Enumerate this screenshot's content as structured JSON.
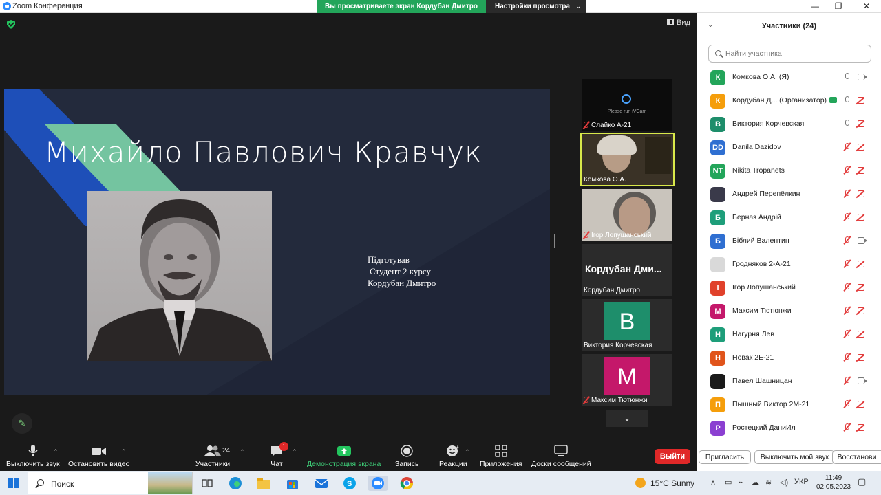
{
  "window": {
    "title": "Zoom Конференция",
    "share_banner": "Вы просматриваете экран Кордубан Дмитро",
    "view_settings": "Настройки просмотра",
    "view_label": "Вид"
  },
  "slide": {
    "name": "Михайло Павлович Кравчук",
    "credit_line1": "Підготував",
    "credit_line2": "Студент 2 курсу",
    "credit_line3": "Кордубан Дмитро"
  },
  "videos": [
    {
      "label": "Слайко А-21",
      "muted": true,
      "note": "Please run iVCam"
    },
    {
      "label": "Комкова О.А.",
      "muted": false
    },
    {
      "label": "Ігор Лопушанський",
      "muted": true
    },
    {
      "label": "Кордубан Дмитро",
      "muted": false,
      "big_name": "Кордубан Дми..."
    },
    {
      "label": "Виктория Корчевская",
      "muted": false,
      "letter": "В",
      "color": "#1e8e6b"
    },
    {
      "label": "Максим Тютюнжи",
      "muted": true,
      "letter": "М",
      "color": "#c4186a"
    }
  ],
  "toolbar": {
    "mute": "Выключить звук",
    "video": "Остановить видео",
    "participants": "Участники",
    "participants_count": "24",
    "chat": "Чат",
    "chat_badge": "1",
    "share": "Демонстрация экрана",
    "record": "Запись",
    "reactions": "Реакции",
    "apps": "Приложения",
    "whiteboards": "Доски сообщений",
    "leave": "Выйти"
  },
  "panel": {
    "title": "Участники (24)",
    "search_placeholder": "Найти участника",
    "participants": [
      {
        "avatar": "К",
        "color": "#23a55a",
        "name": "Комкова О.А. (Я)",
        "mic": "on",
        "cam": "on"
      },
      {
        "avatar": "К",
        "color": "#f59e0b",
        "name": "Кордубан Д... (Организатор)",
        "mic": "on",
        "cam": "off",
        "sharing": true
      },
      {
        "avatar": "В",
        "color": "#1e8e6b",
        "name": "Виктория Корчевская",
        "mic": "on",
        "cam": "off"
      },
      {
        "avatar": "DD",
        "color": "#2f6fd1",
        "name": "Danila Dazidov",
        "mic": "off",
        "cam": "off"
      },
      {
        "avatar": "NT",
        "color": "#23a55a",
        "name": "Nikita Tropanets",
        "mic": "off",
        "cam": "off"
      },
      {
        "avatar": "",
        "color": "#3a3a4a",
        "name": "Андрей Перепёлкин",
        "mic": "off",
        "cam": "off"
      },
      {
        "avatar": "Б",
        "color": "#1e9e7a",
        "name": "Берназ Андрій",
        "mic": "off",
        "cam": "off"
      },
      {
        "avatar": "Б",
        "color": "#2f6fd1",
        "name": "Біблий Валентин",
        "mic": "off",
        "cam": "on"
      },
      {
        "avatar": "",
        "color": "#d9d9d9",
        "name": "Гродняков 2-А-21",
        "mic": "off",
        "cam": "off"
      },
      {
        "avatar": "І",
        "color": "#e0412b",
        "name": "Ігор Лопушанський",
        "mic": "off",
        "cam": "off"
      },
      {
        "avatar": "М",
        "color": "#c4186a",
        "name": "Максим Тютюнжи",
        "mic": "off",
        "cam": "off"
      },
      {
        "avatar": "Н",
        "color": "#1e9e7a",
        "name": "Нагурня Лев",
        "mic": "off",
        "cam": "off"
      },
      {
        "avatar": "Н",
        "color": "#e0541b",
        "name": "Новак 2Е-21",
        "mic": "off",
        "cam": "off"
      },
      {
        "avatar": "",
        "color": "#1a1a1a",
        "name": "Павел Шашницан",
        "mic": "off",
        "cam": "on"
      },
      {
        "avatar": "П",
        "color": "#f59e0b",
        "name": "Пышный Виктор 2М-21",
        "mic": "off",
        "cam": "off"
      },
      {
        "avatar": "Р",
        "color": "#8b3fd1",
        "name": "Ростецкий ДаниИл",
        "mic": "off",
        "cam": "off"
      }
    ],
    "invite": "Пригласить",
    "mute_me": "Выключить мой звук",
    "restore": "Восстанови"
  },
  "taskbar": {
    "search": "Поиск",
    "weather": "15°C  Sunny",
    "lang": "УКР",
    "time": "11:49",
    "date": "02.05.2023"
  }
}
